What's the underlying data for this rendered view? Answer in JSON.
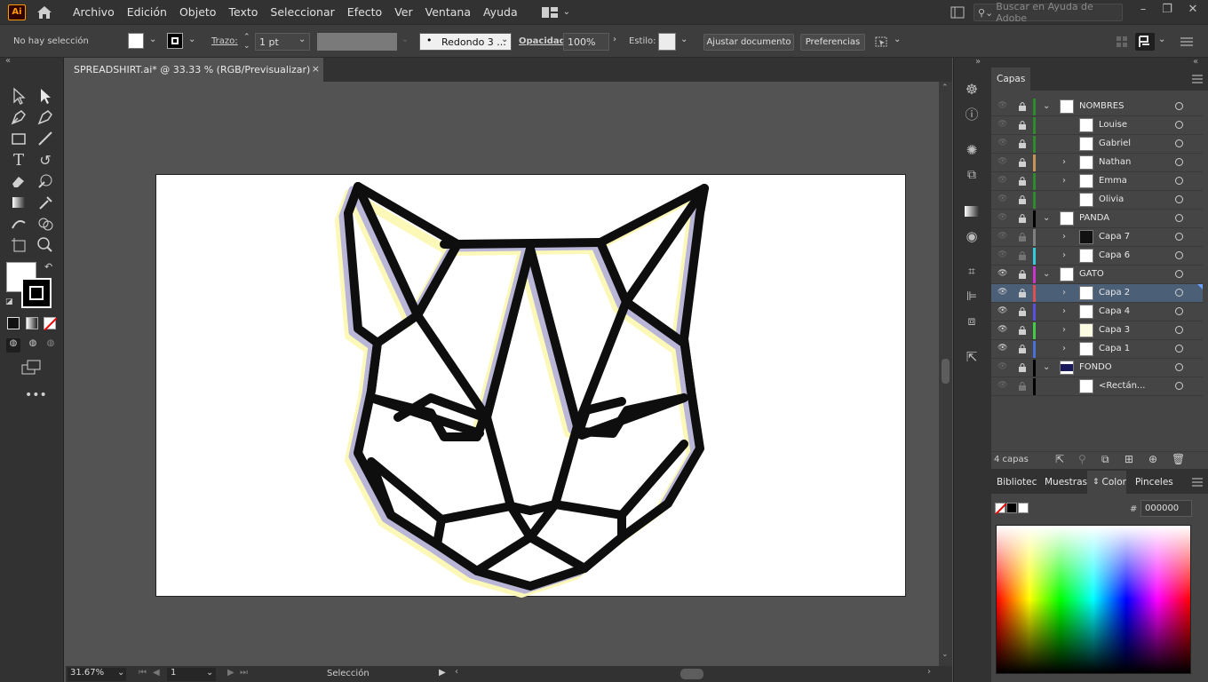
{
  "app": {
    "logo": "Ai"
  },
  "menu": [
    "Archivo",
    "Edición",
    "Objeto",
    "Texto",
    "Seleccionar",
    "Efecto",
    "Ver",
    "Ventana",
    "Ayuda"
  ],
  "search": {
    "placeholder": "Buscar en Ayuda de Adobe"
  },
  "control": {
    "selection": "No hay selección",
    "stroke_label": "Trazo:",
    "stroke_value": "1 pt",
    "brush_value": "Redondo 3 ...",
    "opacity_label": "Opacidad:",
    "opacity_value": "100%",
    "style_label": "Estilo:",
    "fit_button": "Ajustar documento",
    "prefs_button": "Preferencias"
  },
  "document": {
    "tab_title": "SPREADSHIRT.ai* @ 33.33 % (RGB/Previsualizar)",
    "close": "×"
  },
  "status": {
    "zoom": "31.67%",
    "artboard": "1",
    "tool": "Selección"
  },
  "layers_panel": {
    "title": "Capas",
    "count": "4 capas",
    "rows": [
      {
        "name": "NOMBRES",
        "level": 0,
        "color": "#2e8b2e",
        "expand": "open",
        "visible": false
      },
      {
        "name": "Louise",
        "level": 1,
        "color": "#2e8b2e",
        "expand": "none",
        "visible": false
      },
      {
        "name": "Gabriel",
        "level": 1,
        "color": "#2e8b2e",
        "expand": "none",
        "visible": false
      },
      {
        "name": "Nathan",
        "level": 1,
        "color": "#c8935a",
        "expand": "closed",
        "visible": false
      },
      {
        "name": "Emma",
        "level": 1,
        "color": "#2e8b2e",
        "expand": "closed",
        "visible": false
      },
      {
        "name": "Olivia",
        "level": 1,
        "color": "#2e8b2e",
        "expand": "none",
        "visible": false
      },
      {
        "name": "PANDA",
        "level": 0,
        "color": "#000000",
        "expand": "open",
        "visible": false
      },
      {
        "name": "Capa 7",
        "level": 1,
        "color": "#808080",
        "expand": "closed",
        "visible": false
      },
      {
        "name": "Capa 6",
        "level": 1,
        "color": "#33ccdd",
        "expand": "closed",
        "visible": false
      },
      {
        "name": "GATO",
        "level": 0,
        "color": "#cc33cc",
        "expand": "open",
        "visible": true
      },
      {
        "name": "Capa 2",
        "level": 1,
        "color": "#e05050",
        "expand": "closed",
        "visible": true,
        "selected": true
      },
      {
        "name": "Capa 4",
        "level": 1,
        "color": "#5a50e0",
        "expand": "closed",
        "visible": true
      },
      {
        "name": "Capa 3",
        "level": 1,
        "color": "#44cc44",
        "expand": "closed",
        "visible": true
      },
      {
        "name": "Capa 1",
        "level": 1,
        "color": "#4a70d8",
        "expand": "closed",
        "visible": true
      },
      {
        "name": "FONDO",
        "level": 0,
        "color": "#000000",
        "expand": "open",
        "visible": false
      },
      {
        "name": "<Rectán...",
        "level": 1,
        "color": "#000000",
        "expand": "none",
        "visible": false
      }
    ]
  },
  "color_panel": {
    "tabs": [
      "Bibliotec",
      "Muestras",
      "Color",
      "Pinceles"
    ],
    "active_tab": "Color",
    "hex_prefix": "#",
    "hex_value": "000000"
  }
}
